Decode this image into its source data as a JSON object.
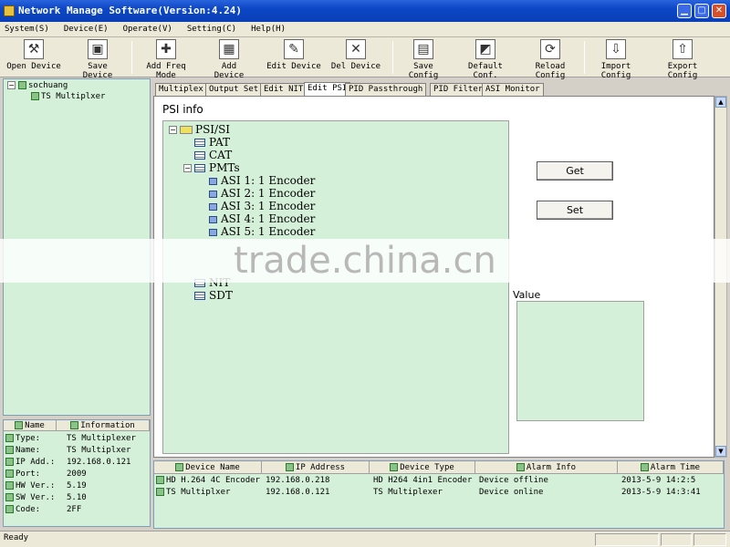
{
  "window": {
    "title": "Network Manage Software(Version:4.24)"
  },
  "menu": [
    "System(S)",
    "Device(E)",
    "Operate(V)",
    "Setting(C)",
    "Help(H)"
  ],
  "toolbar": [
    {
      "label": "Open Device",
      "icon": "open-device-icon",
      "glyph": "⚒"
    },
    {
      "label": "Save Device",
      "icon": "save-device-icon",
      "glyph": "▣"
    },
    {
      "label": "Add Freq Mode",
      "icon": "add-freq-mode-icon",
      "glyph": "✚"
    },
    {
      "label": "Add Device",
      "icon": "add-device-icon",
      "glyph": "▦"
    },
    {
      "label": "Edit Device",
      "icon": "edit-device-icon",
      "glyph": "✎"
    },
    {
      "label": "Del Device",
      "icon": "delete-device-icon",
      "glyph": "✕"
    },
    {
      "label": "Save Config",
      "icon": "save-config-icon",
      "glyph": "▤"
    },
    {
      "label": "Default Conf.",
      "icon": "default-config-icon",
      "glyph": "◩"
    },
    {
      "label": "Reload Config",
      "icon": "reload-config-icon",
      "glyph": "⟳"
    },
    {
      "label": "Import Config",
      "icon": "import-config-icon",
      "glyph": "⇩"
    },
    {
      "label": "Export Config",
      "icon": "export-config-icon",
      "glyph": "⇧"
    }
  ],
  "device_tree": {
    "root": "sochuang",
    "child": "TS Multiplxer"
  },
  "info_panel": {
    "headers": {
      "name": "Name",
      "information": "Information"
    },
    "rows": [
      {
        "label": "Type:",
        "value": "TS Multiplexer"
      },
      {
        "label": "Name:",
        "value": "TS Multiplxer"
      },
      {
        "label": "IP Add.:",
        "value": "192.168.0.121"
      },
      {
        "label": "Port:",
        "value": "2009"
      },
      {
        "label": "HW Ver.:",
        "value": "5.19"
      },
      {
        "label": "SW Ver.:",
        "value": "5.10"
      },
      {
        "label": "Code:",
        "value": "2FF"
      }
    ]
  },
  "tabs": [
    "Multiplex",
    "Output Set",
    "Edit NIT",
    "Edit PSI",
    "PID Passthrough",
    "PID Filter",
    "ASI Monitor"
  ],
  "active_tab": "Edit PSI",
  "psi": {
    "title": "PSI info",
    "root": "PSI/SI",
    "nodes": [
      "PAT",
      "CAT",
      "PMTs"
    ],
    "encoders": [
      "ASI 1: 1 Encoder",
      "ASI 2: 1 Encoder",
      "ASI 3: 1 Encoder",
      "ASI 4: 1 Encoder",
      "ASI 5: 1 Encoder"
    ],
    "trailing": [
      "NIT",
      "SDT"
    ]
  },
  "buttons": {
    "get": "Get",
    "set": "Set"
  },
  "value_label": "Value",
  "watermark": "trade.china.cn",
  "device_table": {
    "headers": [
      "Device Name",
      "IP Address",
      "Device Type",
      "Alarm Info",
      "Alarm Time"
    ],
    "rows": [
      [
        "HD H.264 4C Encoder",
        "192.168.0.218",
        "HD H264 4in1 Encoder",
        "Device offline",
        "2013-5-9 14:2:5"
      ],
      [
        "TS Multiplxer",
        "192.168.0.121",
        "TS Multiplexer",
        "Device online",
        "2013-5-9 14:3:41"
      ]
    ]
  },
  "status": {
    "text": "Ready"
  }
}
